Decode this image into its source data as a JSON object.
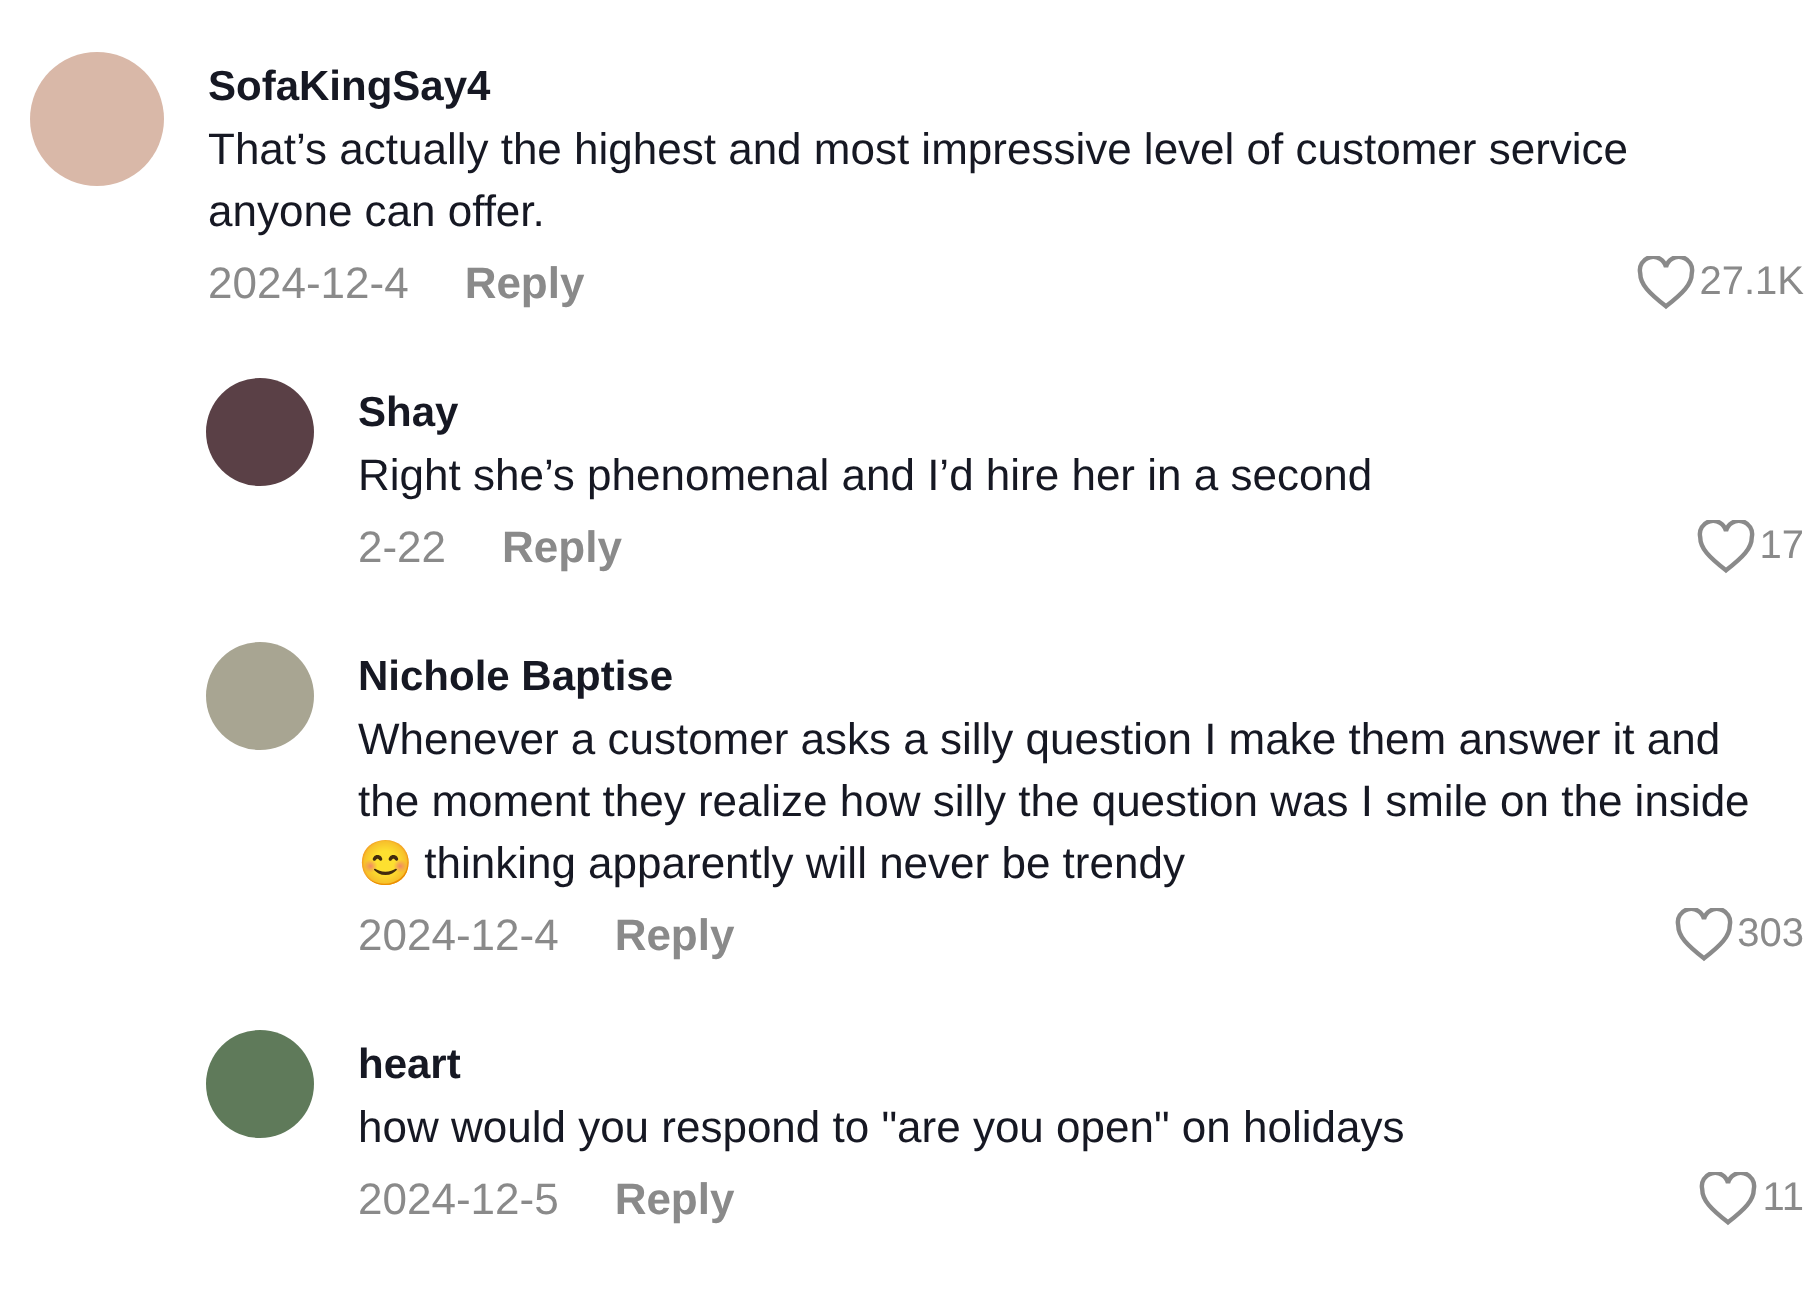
{
  "comments": [
    {
      "author": "SofaKingSay4",
      "text": "That’s actually the highest and most impressive level of customer service anyone can offer.",
      "date": "2024-12-4",
      "reply_label": "Reply",
      "likes": "27.1K",
      "color": "#d9b8a8",
      "replies": [
        {
          "author": "Shay",
          "text": "Right she’s phenomenal and I’d hire her in a second",
          "date": "2-22",
          "reply_label": "Reply",
          "likes": "17",
          "color": "#5a4046"
        },
        {
          "author": "Nichole Baptise",
          "text": "Whenever a customer asks a silly question I make them answer it and the moment they realize how silly the question was I smile on the inside 😊 thinking apparently will never be trendy",
          "date": "2024-12-4",
          "reply_label": "Reply",
          "likes": "303",
          "color": "#a8a592"
        },
        {
          "author": "heart",
          "text": "how would you respond to \"are you open\" on holidays",
          "date": "2024-12-5",
          "reply_label": "Reply",
          "likes": "11",
          "color": "#5f7a5a"
        }
      ]
    }
  ]
}
